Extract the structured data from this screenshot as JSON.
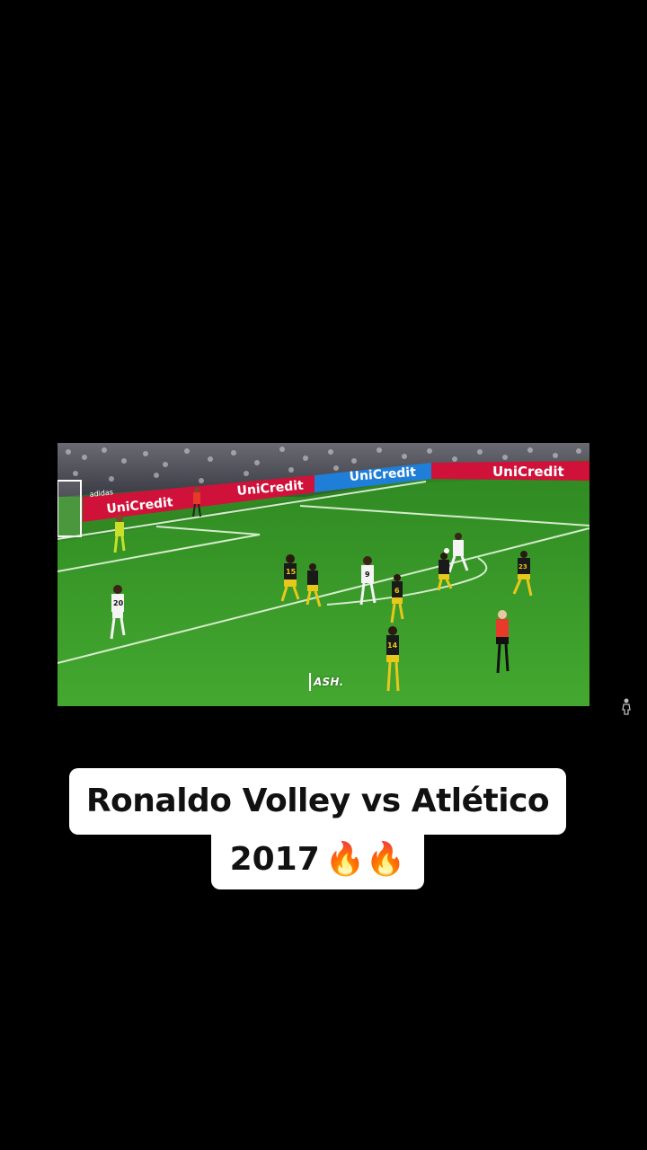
{
  "video": {
    "watermark": "ASH.",
    "board_text": "UniCredit",
    "side_board_text": "adidas",
    "player_numbers": {
      "white_left": "20",
      "white_center": "9",
      "yellow_front": "14",
      "yellow_right": "23",
      "yellow_mid": "6",
      "yellow_left": "15"
    }
  },
  "caption": {
    "line1": "Ronaldo Volley vs Atlético",
    "line2_year": "2017",
    "line2_emoji": "🔥🔥"
  },
  "colors": {
    "background": "#000000",
    "pitch": "#3d9a2a",
    "board_red": "#d0123a",
    "board_blue": "#1f7fd8",
    "caption_bg": "#ffffff"
  },
  "icons": {
    "side": "person-icon"
  }
}
